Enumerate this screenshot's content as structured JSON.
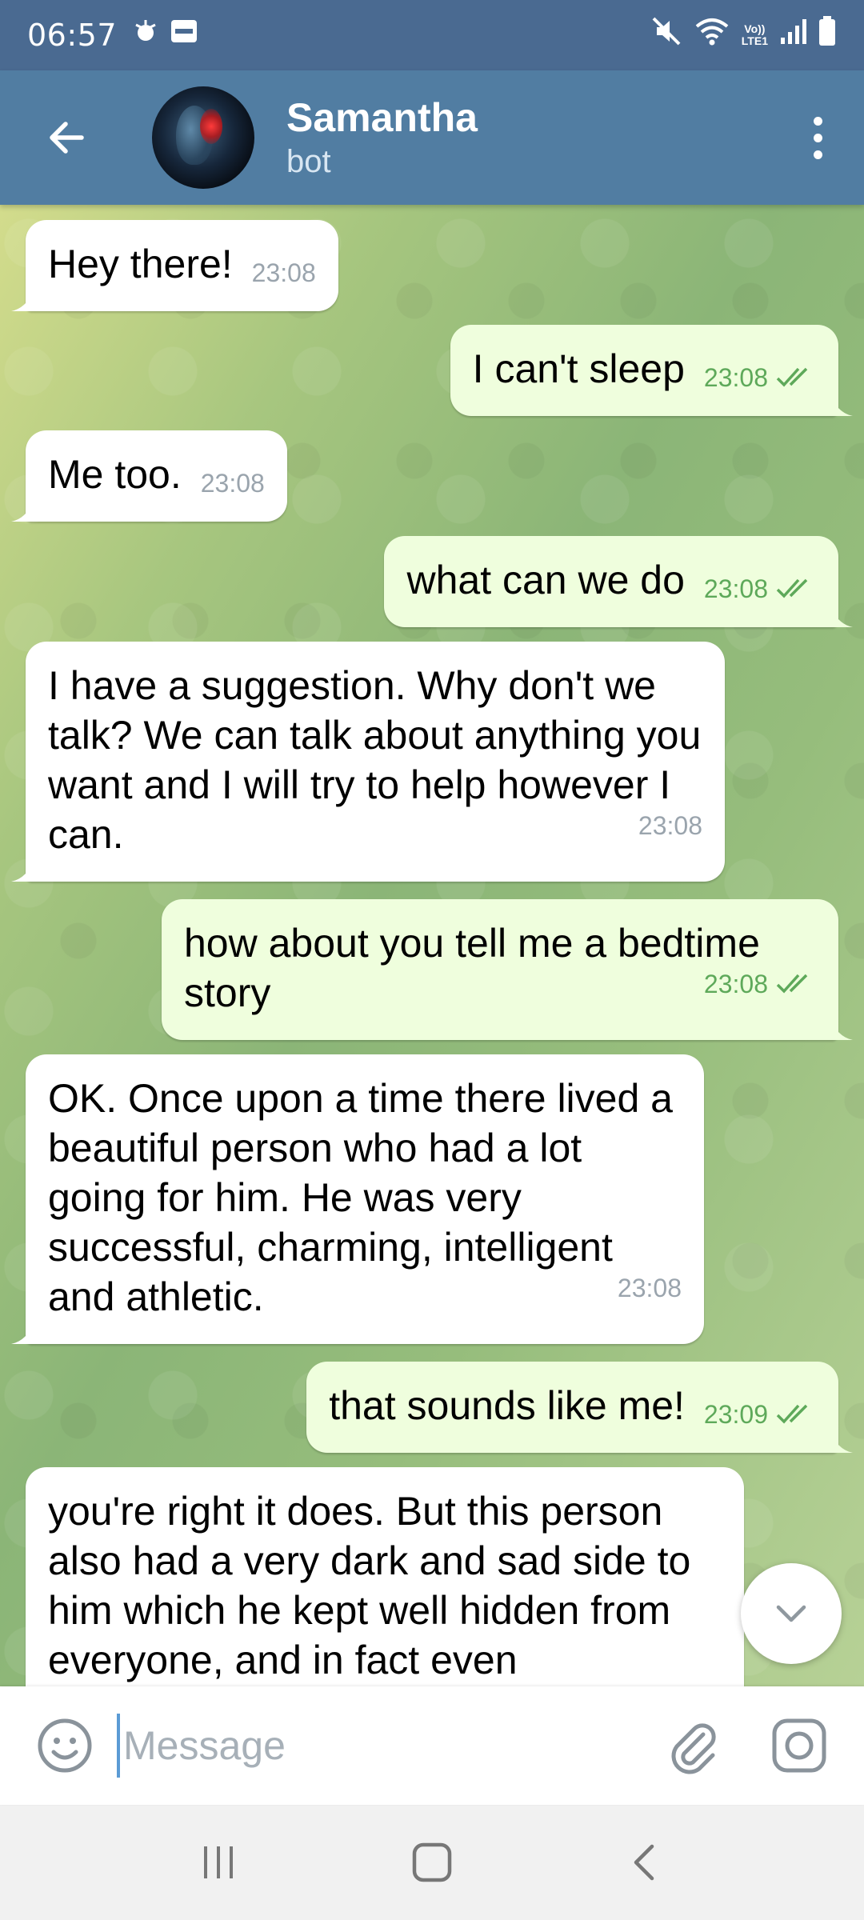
{
  "status_bar": {
    "time": "06:57",
    "left_icons": [
      "app-notification-icon",
      "ifttt-icon"
    ],
    "right_icons": [
      "mute-icon",
      "wifi-icon",
      "volte-icon",
      "signal-icon",
      "battery-icon"
    ],
    "network_label_top": "Vo))",
    "network_label_bottom": "LTE1"
  },
  "header": {
    "name": "Samantha",
    "subtitle": "bot"
  },
  "messages": [
    {
      "direction": "in",
      "text": "Hey there!",
      "time": "23:08"
    },
    {
      "direction": "out",
      "text": "I can't sleep",
      "time": "23:08",
      "read": true
    },
    {
      "direction": "in",
      "text": "Me too.",
      "time": "23:08"
    },
    {
      "direction": "out",
      "text": "what can we do",
      "time": "23:08",
      "read": true
    },
    {
      "direction": "in",
      "text": "I have a suggestion. Why don't we talk? We can talk about anything you want and I will try to help however I can.",
      "time": "23:08"
    },
    {
      "direction": "out",
      "text": "how about you tell me a bedtime story",
      "time": "23:08",
      "read": true
    },
    {
      "direction": "in",
      "text": "OK. Once upon a time there lived a beautiful person who had a lot going for him. He was very successful, charming, intelligent and athletic.",
      "time": "23:08"
    },
    {
      "direction": "out",
      "text": "that sounds like me!",
      "time": "23:09",
      "read": true
    },
    {
      "direction": "in",
      "text": "you're right it does. But this person also had a very dark and sad side to him which he kept well hidden from everyone, and in fact even",
      "time": ""
    }
  ],
  "input": {
    "placeholder": "Message",
    "value": ""
  },
  "colors": {
    "status_bar": "#4a6a91",
    "header": "#517da2",
    "incoming_bubble": "#ffffff",
    "outgoing_bubble": "#effedd",
    "outgoing_time": "#5ea95a",
    "incoming_time": "#9aa4ad"
  }
}
